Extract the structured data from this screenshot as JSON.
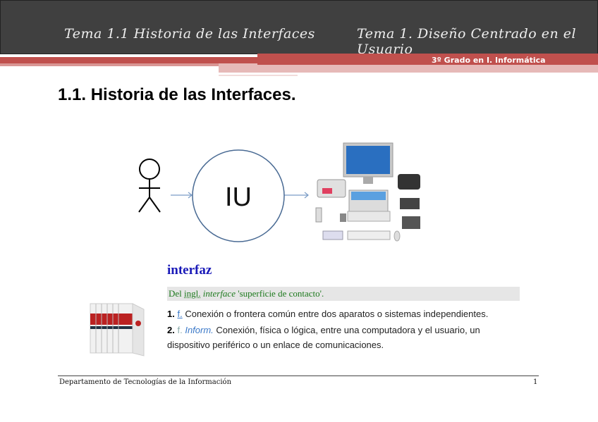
{
  "header": {
    "left_title": "Tema 1.1 Historia de las Interfaces",
    "right_title": "Tema 1. Diseño Centrado en el Usuario",
    "subtitle": "3º Grado en I. Informática"
  },
  "page_title": "1.1. Historia de las Interfaces.",
  "diagram": {
    "center_label": "IU"
  },
  "dictionary": {
    "word": "interfaz",
    "etymology": {
      "prefix": "Del",
      "lang": "ingl.",
      "term": "interface",
      "gloss": "'superficie de contacto'."
    },
    "definitions": [
      {
        "num": "1.",
        "gram": "f.",
        "domain": "",
        "text": "Conexión o frontera común entre dos aparatos o sistemas independientes."
      },
      {
        "num": "2.",
        "gram": "f.",
        "domain": "Inform.",
        "text": "Conexión, física o lógica, entre una computadora y el usuario, un dispositivo periférico o un enlace de comunicaciones."
      }
    ]
  },
  "footer": {
    "department": "Departamento de Tecnologías de la Información",
    "page": "1"
  }
}
